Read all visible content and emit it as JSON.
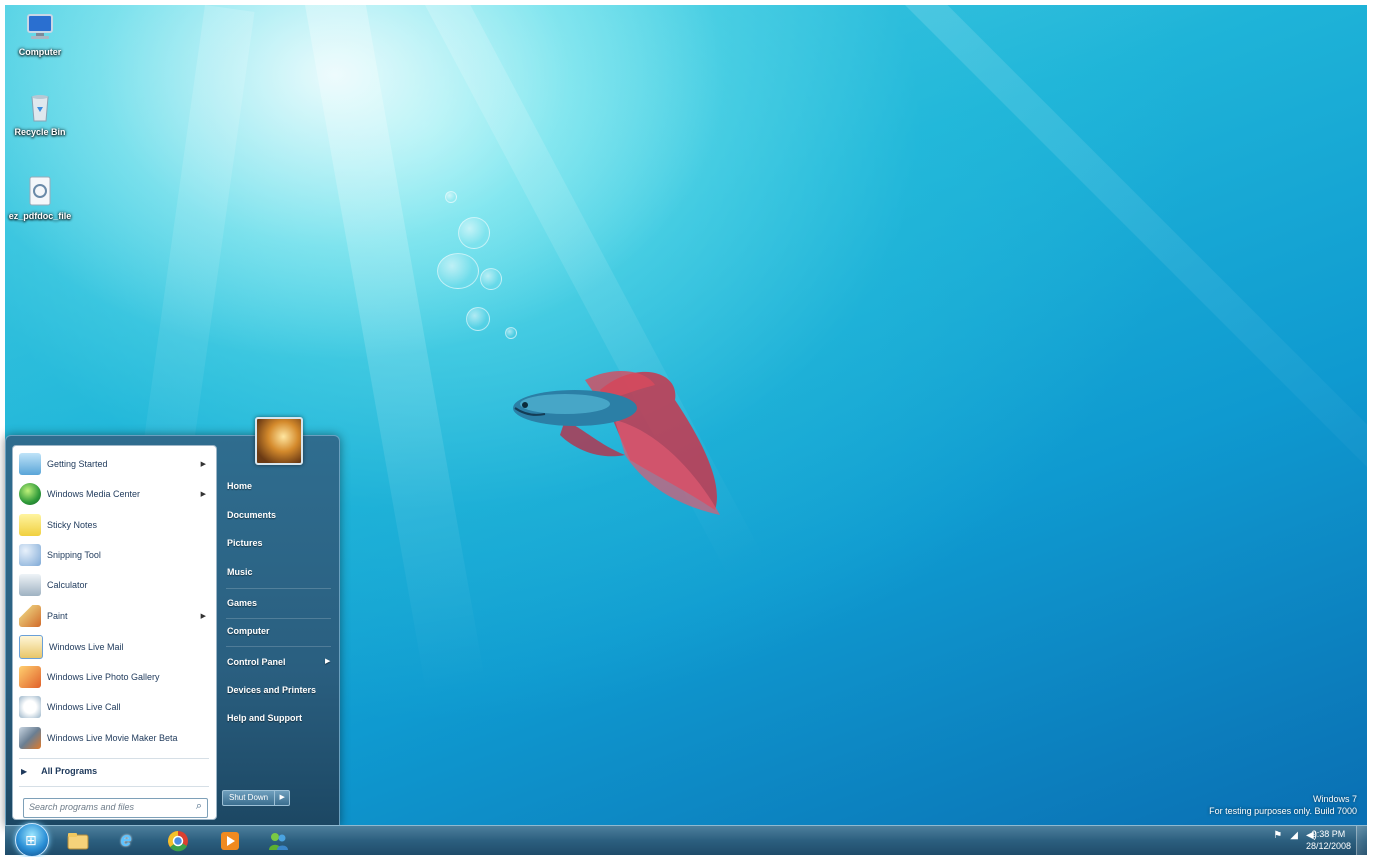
{
  "desktop": {
    "icons": [
      {
        "label": "Computer",
        "icon": "computer-icon"
      },
      {
        "label": "Recycle Bin",
        "icon": "recycle-bin-icon"
      },
      {
        "label": "ez_pdfdoc_file",
        "icon": "file-icon"
      }
    ],
    "watermark": {
      "line1": "Windows 7",
      "line2": "For testing purposes only. Build 7000"
    }
  },
  "start_menu": {
    "programs": [
      {
        "label": "Getting Started",
        "icon": "getting-started-icon",
        "has_submenu": true
      },
      {
        "label": "Windows Media Center",
        "icon": "media-center-icon",
        "has_submenu": true
      },
      {
        "label": "Sticky Notes",
        "icon": "sticky-notes-icon",
        "has_submenu": false
      },
      {
        "label": "Snipping Tool",
        "icon": "snipping-tool-icon",
        "has_submenu": false
      },
      {
        "label": "Calculator",
        "icon": "calculator-icon",
        "has_submenu": false
      },
      {
        "label": "Paint",
        "icon": "paint-icon",
        "has_submenu": true
      },
      {
        "label": "Windows Live Mail",
        "icon": "live-mail-icon",
        "has_submenu": false
      },
      {
        "label": "Windows Live Photo Gallery",
        "icon": "photo-gallery-icon",
        "has_submenu": false
      },
      {
        "label": "Windows Live Call",
        "icon": "live-call-icon",
        "has_submenu": false
      },
      {
        "label": "Windows Live Movie Maker Beta",
        "icon": "movie-maker-icon",
        "has_submenu": false
      }
    ],
    "all_programs": "All Programs",
    "search_placeholder": "Search programs and files",
    "places": [
      {
        "label": "Home",
        "has_submenu": false
      },
      {
        "label": "Documents",
        "has_submenu": false
      },
      {
        "label": "Pictures",
        "has_submenu": false
      },
      {
        "label": "Music",
        "has_submenu": false
      },
      {
        "label": "Games",
        "has_submenu": false
      },
      {
        "label": "Computer",
        "has_submenu": false
      },
      {
        "label": "Control Panel",
        "has_submenu": true
      },
      {
        "label": "Devices and Printers",
        "has_submenu": false
      },
      {
        "label": "Help and Support",
        "has_submenu": false
      }
    ],
    "shutdown_label": "Shut Down"
  },
  "taskbar": {
    "pinned": [
      "explorer-icon",
      "internet-explorer-icon",
      "chrome-icon",
      "media-player-icon",
      "messenger-icon"
    ],
    "clock_time": "9:38 PM",
    "clock_date": "28/12/2008"
  }
}
